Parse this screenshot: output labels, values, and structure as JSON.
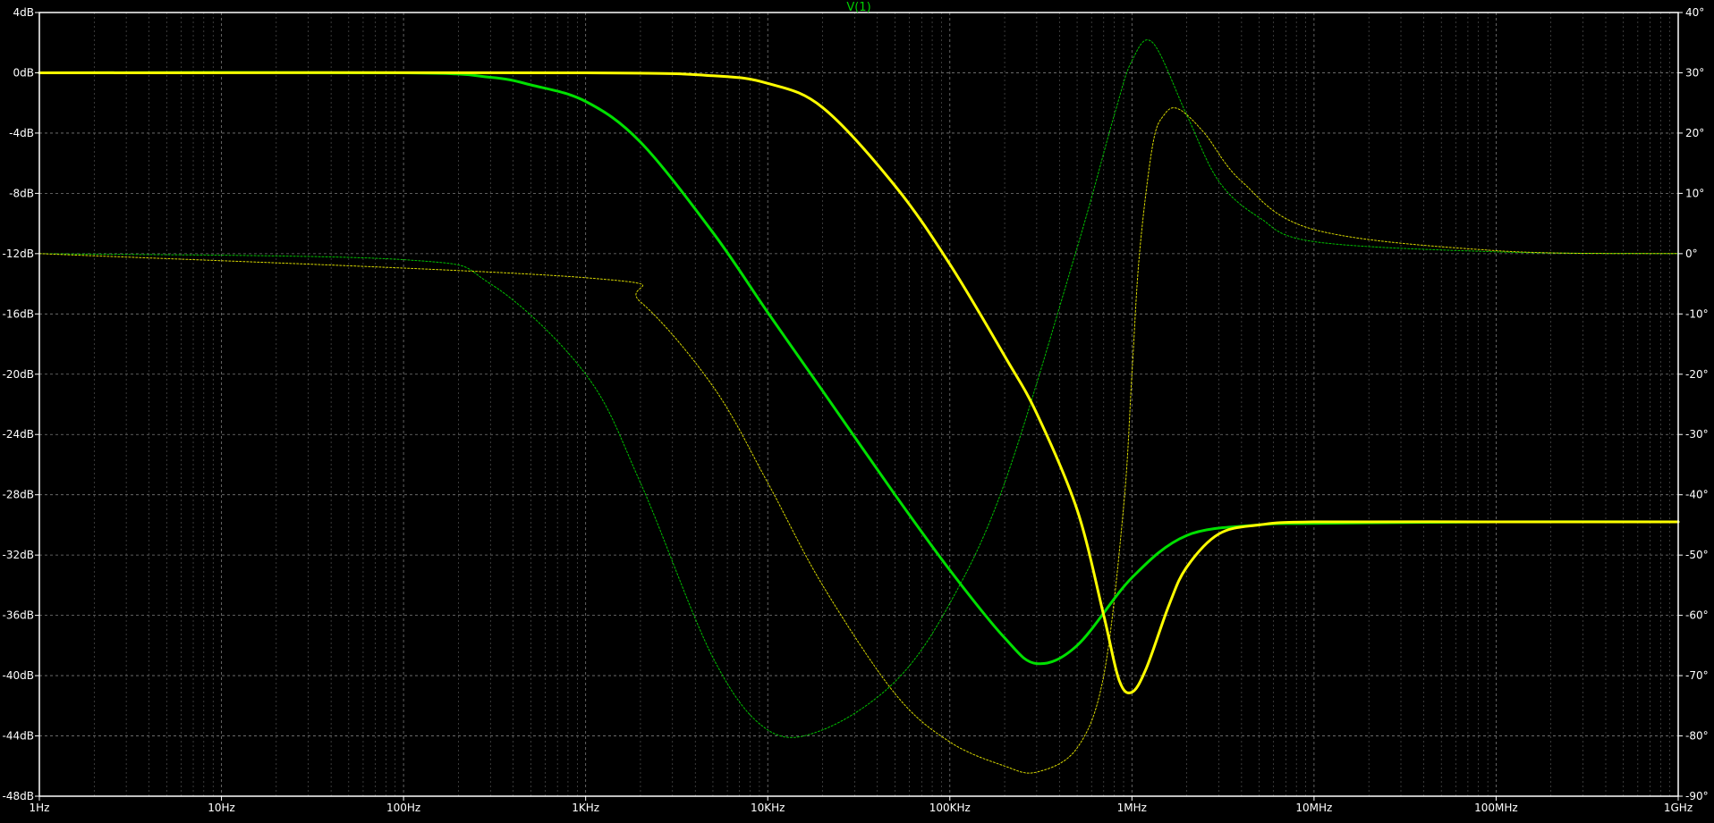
{
  "chart_data": {
    "type": "line",
    "title": "V(1)",
    "x_scale": "log",
    "xlim_hz": [
      1,
      1000000000
    ],
    "x_tick_labels": [
      "1Hz",
      "10Hz",
      "100Hz",
      "1KHz",
      "10KHz",
      "100KHz",
      "1MHz",
      "10MHz",
      "100MHz",
      "1GHz"
    ],
    "y_left": {
      "unit": "dB",
      "ylim": [
        -48,
        4
      ],
      "tick_labels": [
        "4dB",
        "0dB",
        "-4dB",
        "-8dB",
        "-12dB",
        "-16dB",
        "-20dB",
        "-24dB",
        "-28dB",
        "-32dB",
        "-36dB",
        "-40dB",
        "-44dB",
        "-48dB"
      ]
    },
    "y_right": {
      "unit": "deg",
      "ylim": [
        -90,
        40
      ],
      "tick_labels": [
        "40°",
        "30°",
        "20°",
        "10°",
        "0°",
        "-10°",
        "-20°",
        "-30°",
        "-40°",
        "-50°",
        "-60°",
        "-70°",
        "-80°",
        "-90°"
      ]
    },
    "grid": true,
    "background": "#000000",
    "axis_color": "#ffffff",
    "grid_color": "#7a7a7a",
    "title_color": "#00d000",
    "series": [
      {
        "color": "#00e000",
        "quantity": "magnitude",
        "axis": "left",
        "x": [
          1,
          100,
          300,
          500,
          1000,
          2000,
          5000,
          10000,
          20000,
          50000,
          100000,
          200000,
          300000,
          500000,
          1000000,
          2000000,
          5000000,
          10000000,
          100000000,
          1000000000
        ],
        "y": [
          0,
          0,
          -0.3,
          -0.8,
          -1.9,
          -4.6,
          -10.6,
          -15.9,
          -21.1,
          -28,
          -33,
          -37.5,
          -39.2,
          -38,
          -33.5,
          -30.7,
          -30,
          -29.9,
          -29.8,
          -29.8
        ]
      },
      {
        "color": "#ffff00",
        "quantity": "magnitude",
        "axis": "left",
        "x": [
          1,
          1000,
          5000,
          10000,
          20000,
          50000,
          100000,
          200000,
          300000,
          500000,
          700000,
          850000,
          1000000,
          1200000,
          1600000,
          2000000,
          3000000,
          5000000,
          10000000,
          100000000,
          1000000000
        ],
        "y": [
          0,
          0,
          -0.2,
          -0.7,
          -2.3,
          -7.5,
          -12.7,
          -18.8,
          -22.6,
          -29,
          -36,
          -40.3,
          -41.1,
          -39.5,
          -35.3,
          -32.8,
          -30.6,
          -30,
          -29.8,
          -29.8,
          -29.8
        ]
      },
      {
        "color": "#00c000",
        "quantity": "phase",
        "axis": "right",
        "x": [
          1,
          100,
          300,
          1000,
          2000,
          5000,
          10000,
          20000,
          50000,
          100000,
          200000,
          500000,
          800000,
          1000000,
          1300000,
          2000000,
          3000000,
          5000000,
          10000000,
          100000000,
          1000000000
        ],
        "y": [
          0,
          -1,
          -5,
          -20,
          -38,
          -67,
          -79,
          -79,
          -71,
          -58,
          -38,
          1,
          23,
          32,
          35,
          23,
          12,
          6,
          2,
          0.3,
          0
        ]
      },
      {
        "color": "#d8d800",
        "quantity": "phase",
        "axis": "right",
        "x": [
          1,
          1000,
          2000,
          5000,
          10000,
          20000,
          50000,
          100000,
          200000,
          300000,
          500000,
          700000,
          900000,
          1000000,
          1100000,
          1300000,
          1500000,
          1800000,
          2500000,
          4000000,
          10000000,
          100000000,
          1000000000
        ],
        "y": [
          0,
          -4,
          -8,
          -22,
          -38,
          -55,
          -73,
          -81,
          -85,
          -86,
          -82,
          -70,
          -42,
          -20,
          0,
          18,
          23,
          24,
          20,
          12,
          4,
          0.5,
          0
        ]
      }
    ]
  }
}
